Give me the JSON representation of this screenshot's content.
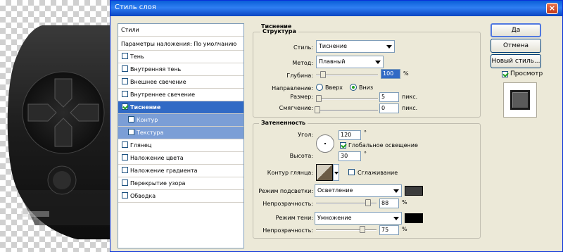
{
  "window": {
    "title": "Стиль слоя",
    "close_glyph": "×"
  },
  "styles_list": {
    "header": "Стили",
    "blend_options": "Параметры наложения: По умолчанию",
    "items": [
      {
        "label": "Тень",
        "checked": false
      },
      {
        "label": "Внутренняя тень",
        "checked": false
      },
      {
        "label": "Внешнее свечение",
        "checked": false
      },
      {
        "label": "Внутреннее свечение",
        "checked": false
      },
      {
        "label": "Тиснение",
        "checked": true,
        "selected": true
      },
      {
        "label": "Контур",
        "checked": false,
        "sub": true
      },
      {
        "label": "Текстура",
        "checked": false,
        "sub": true
      },
      {
        "label": "Глянец",
        "checked": false
      },
      {
        "label": "Наложение цвета",
        "checked": false
      },
      {
        "label": "Наложение градиента",
        "checked": false
      },
      {
        "label": "Перекрытие узора",
        "checked": false
      },
      {
        "label": "Обводка",
        "checked": false
      }
    ]
  },
  "emboss": {
    "section_title": "Тиснение",
    "structure_title": "Структура",
    "style_label": "Стиль:",
    "style_value": "Тиснение",
    "method_label": "Метод:",
    "method_value": "Плавный",
    "depth_label": "Глубина:",
    "depth_value": "100",
    "depth_unit": "%",
    "direction_label": "Направление:",
    "direction_up": "Вверх",
    "direction_down": "Вниз",
    "direction_selected": "down",
    "size_label": "Размер:",
    "size_value": "5",
    "size_unit": "пикс.",
    "soften_label": "Смягчение:",
    "soften_value": "0",
    "soften_unit": "пикс."
  },
  "shading": {
    "title": "Затененность",
    "angle_label": "Угол:",
    "angle_value": "120",
    "angle_unit": "°",
    "global_light_label": "Глобальное освещение",
    "global_light_checked": true,
    "altitude_label": "Высота:",
    "altitude_value": "30",
    "altitude_unit": "°",
    "gloss_contour_label": "Контур глянца:",
    "antialias_label": "Сглаживание",
    "antialias_checked": false,
    "highlight_mode_label": "Режим подсветки:",
    "highlight_mode_value": "Осветление",
    "highlight_color": "#3c3c3c",
    "highlight_opacity_label": "Непрозрачность:",
    "highlight_opacity_value": "88",
    "highlight_opacity_unit": "%",
    "shadow_mode_label": "Режим тени:",
    "shadow_mode_value": "Умножение",
    "shadow_color": "#000000",
    "shadow_opacity_label": "Непрозрачность:",
    "shadow_opacity_value": "75",
    "shadow_opacity_unit": "%"
  },
  "buttons": {
    "ok": "Да",
    "cancel": "Отмена",
    "new_style": "Новый стиль...",
    "preview_label": "Просмотр",
    "preview_checked": true
  }
}
